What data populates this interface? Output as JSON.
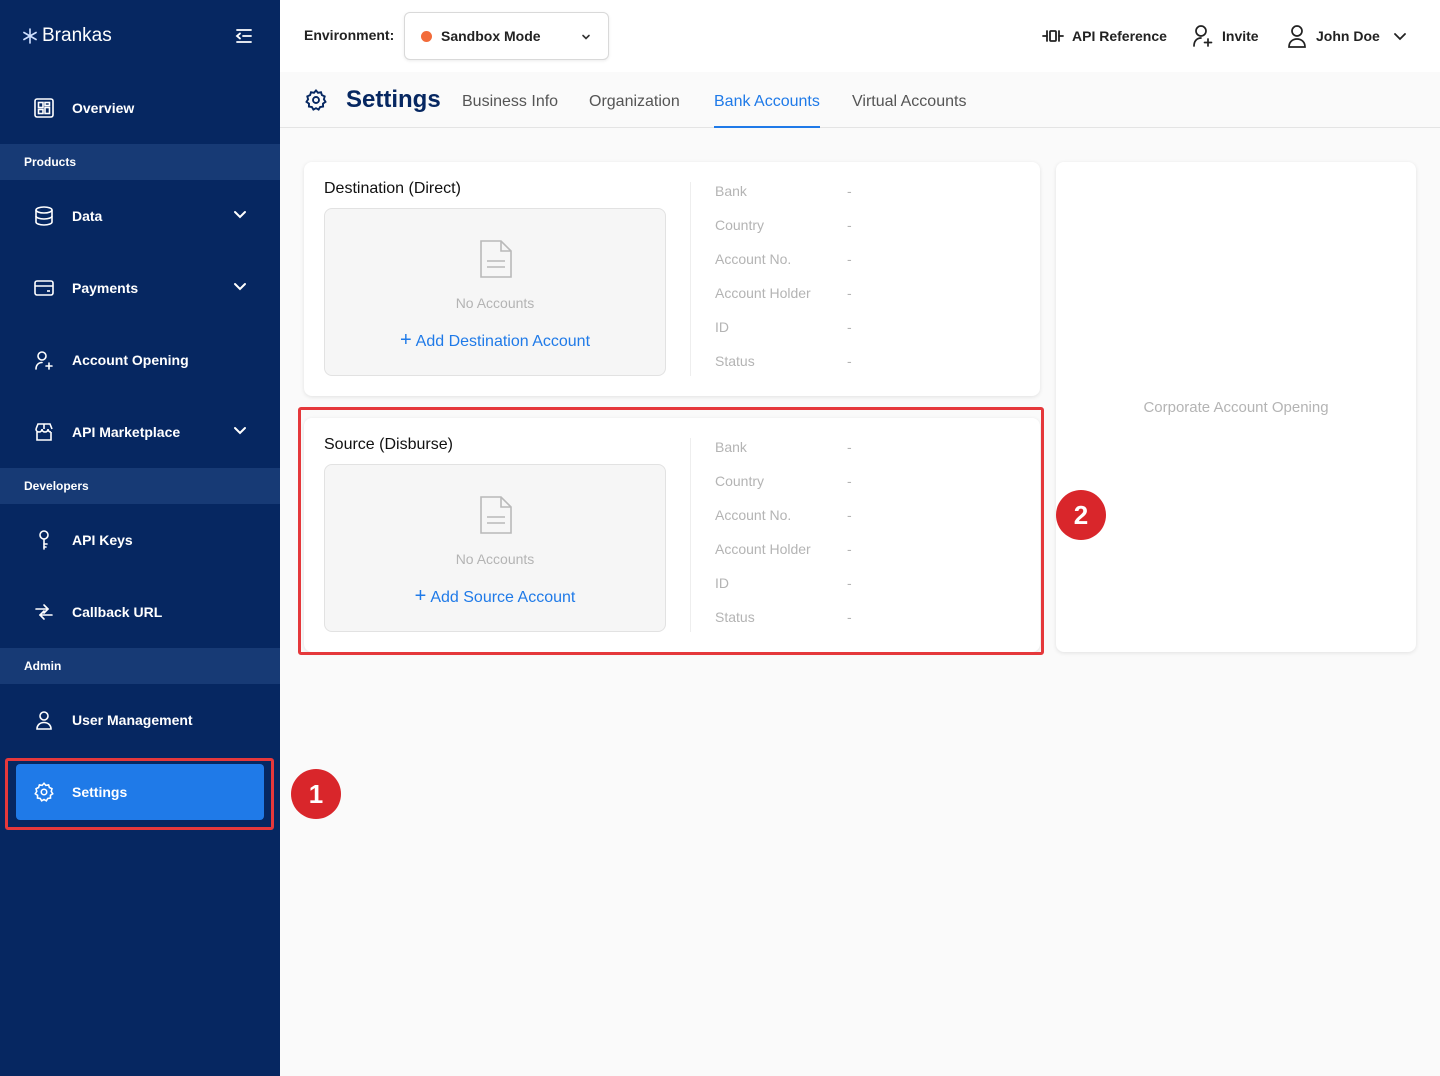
{
  "brand": {
    "name": "Brankas"
  },
  "sidebar": {
    "overview": "Overview",
    "section_products": "Products",
    "data": "Data",
    "payments": "Payments",
    "account_opening": "Account Opening",
    "api_marketplace": "API Marketplace",
    "section_developers": "Developers",
    "api_keys": "API Keys",
    "callback_url": "Callback URL",
    "section_admin": "Admin",
    "user_management": "User Management",
    "settings": "Settings"
  },
  "topbar": {
    "env_label": "Environment:",
    "env_value": "Sandbox Mode",
    "env_dot_color": "#f26b3a",
    "api_reference": "API Reference",
    "invite": "Invite",
    "user": "John Doe"
  },
  "settings": {
    "title": "Settings",
    "tabs": [
      "Business Info",
      "Organization",
      "Bank Accounts",
      "Virtual Accounts"
    ],
    "active_tab": "Bank Accounts"
  },
  "destination": {
    "title": "Destination (Direct)",
    "empty": "No Accounts",
    "add": "Add Destination Account",
    "fields": [
      {
        "label": "Bank",
        "value": "-"
      },
      {
        "label": "Country",
        "value": "-"
      },
      {
        "label": "Account No.",
        "value": "-"
      },
      {
        "label": "Account Holder",
        "value": "-"
      },
      {
        "label": "ID",
        "value": "-"
      },
      {
        "label": "Status",
        "value": "-"
      }
    ]
  },
  "source": {
    "title": "Source (Disburse)",
    "empty": "No Accounts",
    "add": "Add Source Account",
    "fields": [
      {
        "label": "Bank",
        "value": "-"
      },
      {
        "label": "Country",
        "value": "-"
      },
      {
        "label": "Account No.",
        "value": "-"
      },
      {
        "label": "Account Holder",
        "value": "-"
      },
      {
        "label": "ID",
        "value": "-"
      },
      {
        "label": "Status",
        "value": "-"
      }
    ]
  },
  "corporate": {
    "label": "Corporate Account Opening"
  },
  "annotations": {
    "badge1": "1",
    "badge2": "2",
    "highlight_color": "#e5383b"
  },
  "colors": {
    "sidebar_bg": "#062761",
    "accent": "#1f7ae8"
  }
}
